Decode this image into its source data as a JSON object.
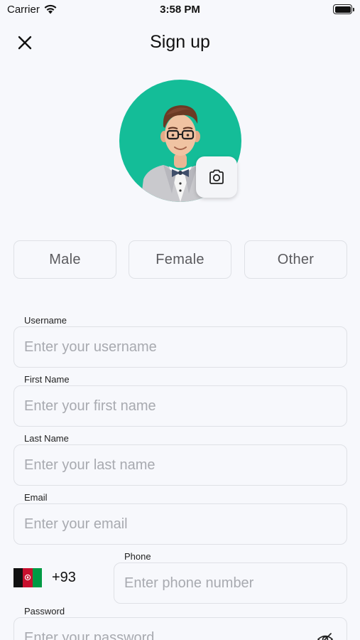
{
  "status_bar": {
    "carrier": "Carrier",
    "time": "3:58 PM",
    "wifi_icon": "wifi-icon",
    "battery_icon": "battery-icon"
  },
  "nav": {
    "title": "Sign up",
    "close_icon": "close-icon"
  },
  "avatar": {
    "background_color": "#14bd98",
    "camera_icon": "camera-icon"
  },
  "gender": {
    "options": [
      "Male",
      "Female",
      "Other"
    ]
  },
  "form": {
    "username": {
      "label": "Username",
      "placeholder": "Enter your username",
      "value": ""
    },
    "first_name": {
      "label": "First Name",
      "placeholder": "Enter your first name",
      "value": ""
    },
    "last_name": {
      "label": "Last Name",
      "placeholder": "Enter your last name",
      "value": ""
    },
    "email": {
      "label": "Email",
      "placeholder": "Enter your email",
      "value": ""
    },
    "phone": {
      "country_code": "+93",
      "flag_icon": "afghanistan-flag-icon",
      "label": "Phone",
      "placeholder": "Enter phone number",
      "value": ""
    },
    "password": {
      "label": "Password",
      "placeholder": "Enter your password",
      "value": "",
      "visibility_icon": "eye-off-icon"
    }
  },
  "colors": {
    "background": "#f7f8fc",
    "border": "#dfe1e6",
    "accent": "#14bd98",
    "placeholder": "#a8aab0"
  }
}
